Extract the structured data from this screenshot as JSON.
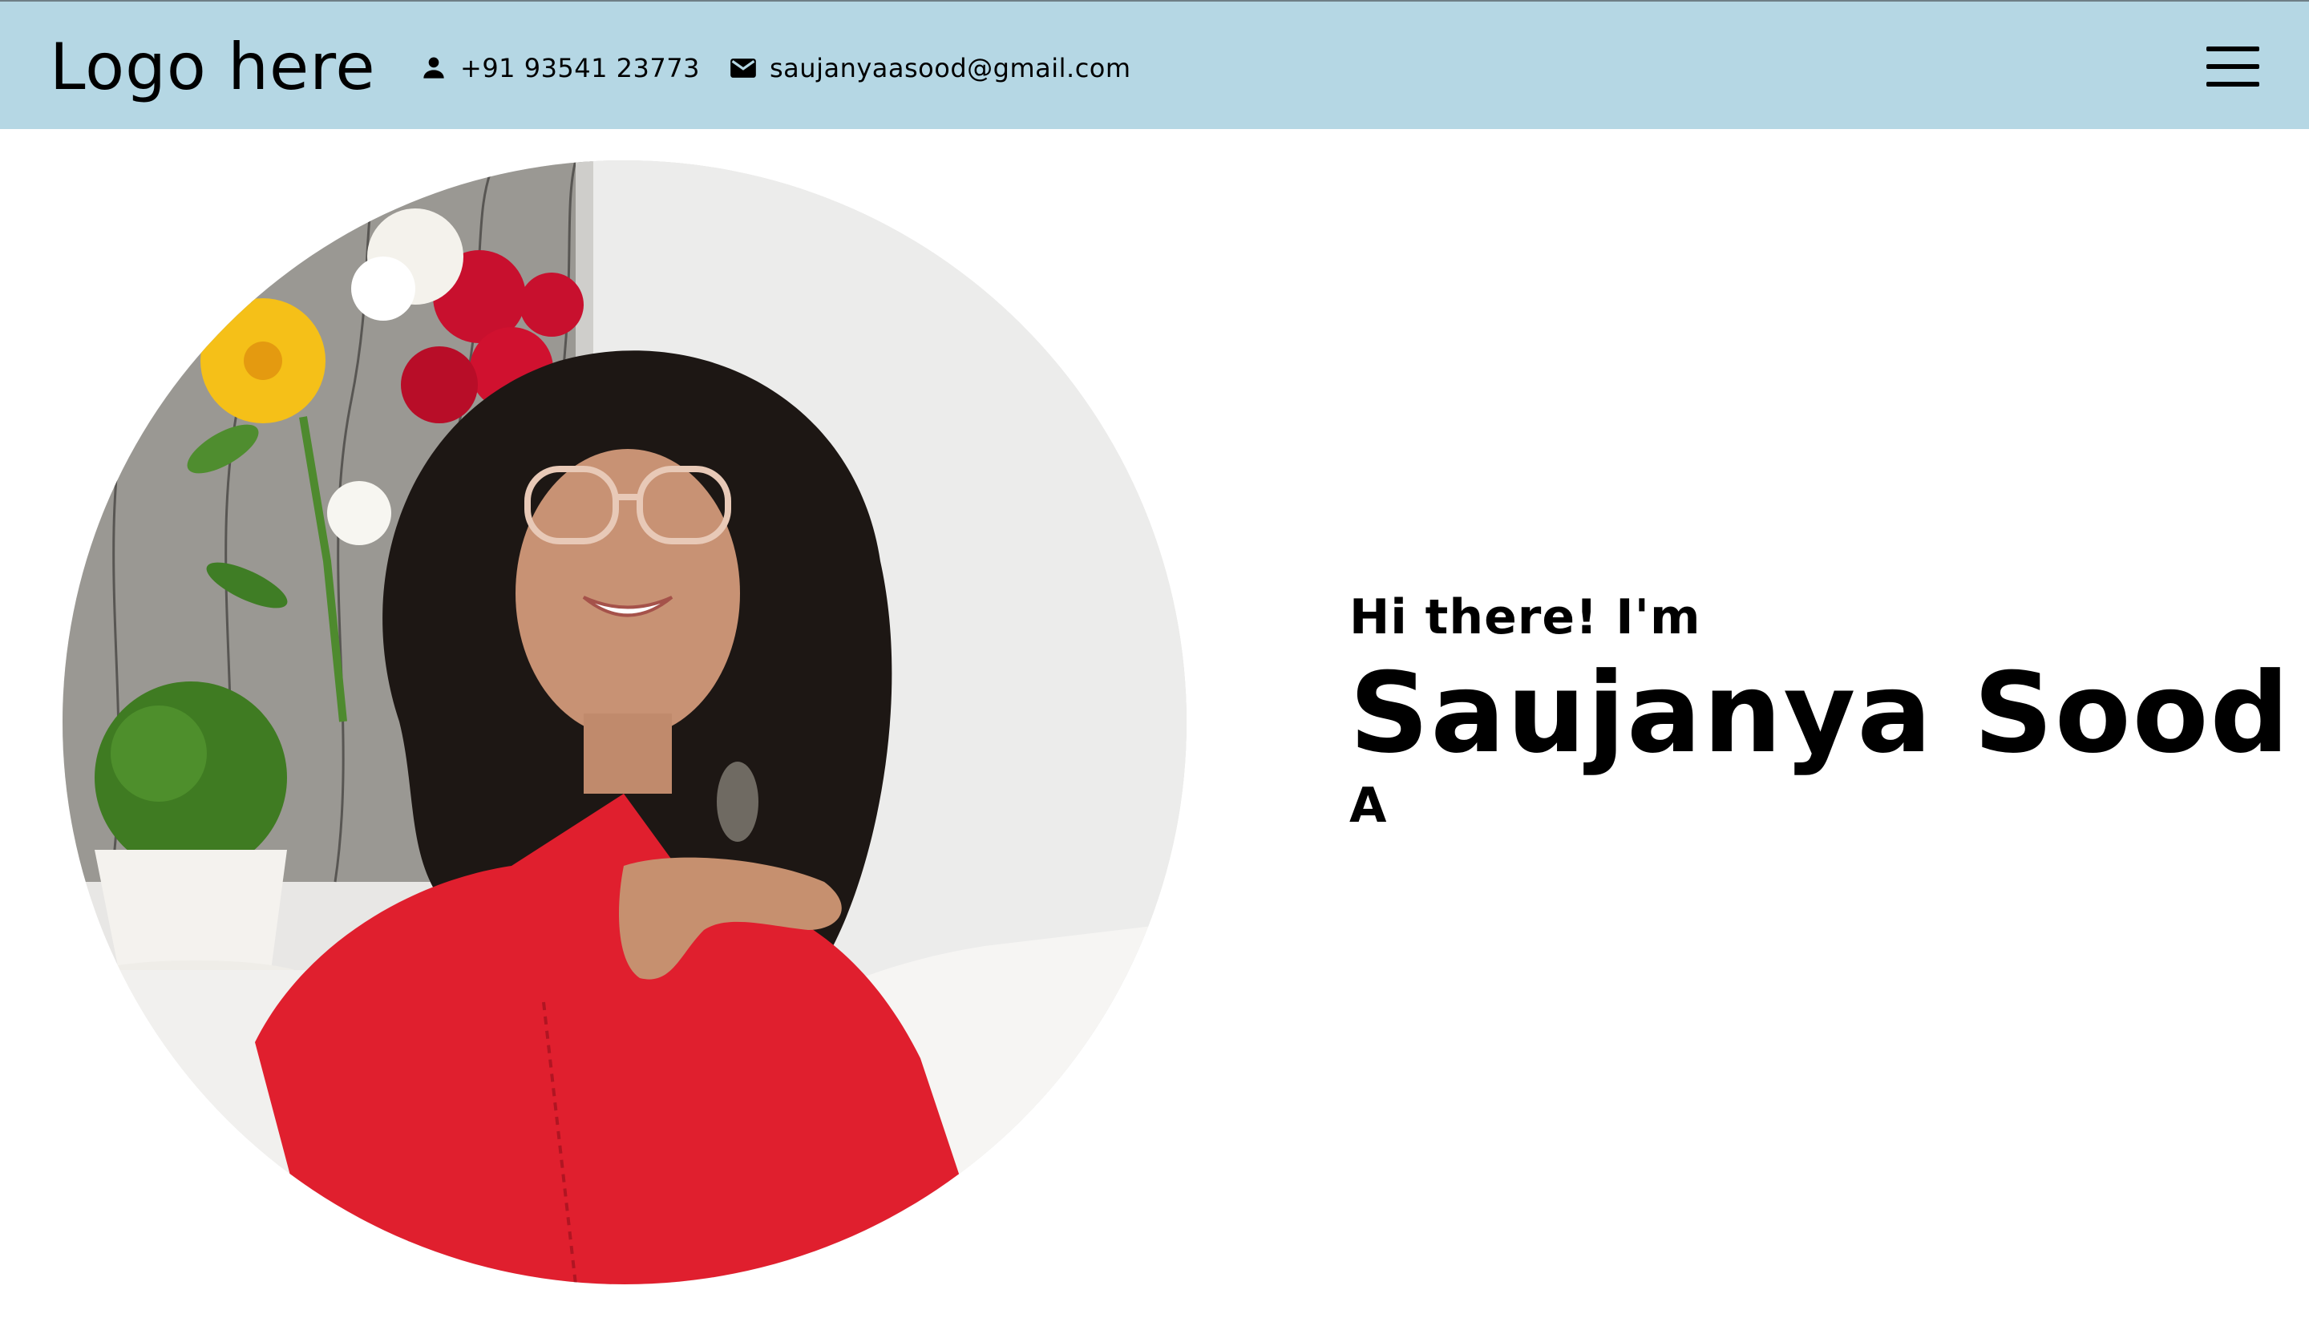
{
  "header": {
    "logo": "Logo here",
    "phone": "+91 93541 23773",
    "email": "saujanyaasood@gmail.com",
    "phone_icon": "person-icon",
    "email_icon": "mail-icon",
    "menu_icon": "hamburger-menu-icon",
    "background_color": "#b5d7e4"
  },
  "hero": {
    "greeting": "Hi there! I'm",
    "name": "Saujanya Sood",
    "typed_role": "A"
  },
  "colors": {
    "outfit_red": "#e01f2e",
    "text": "#000000"
  }
}
